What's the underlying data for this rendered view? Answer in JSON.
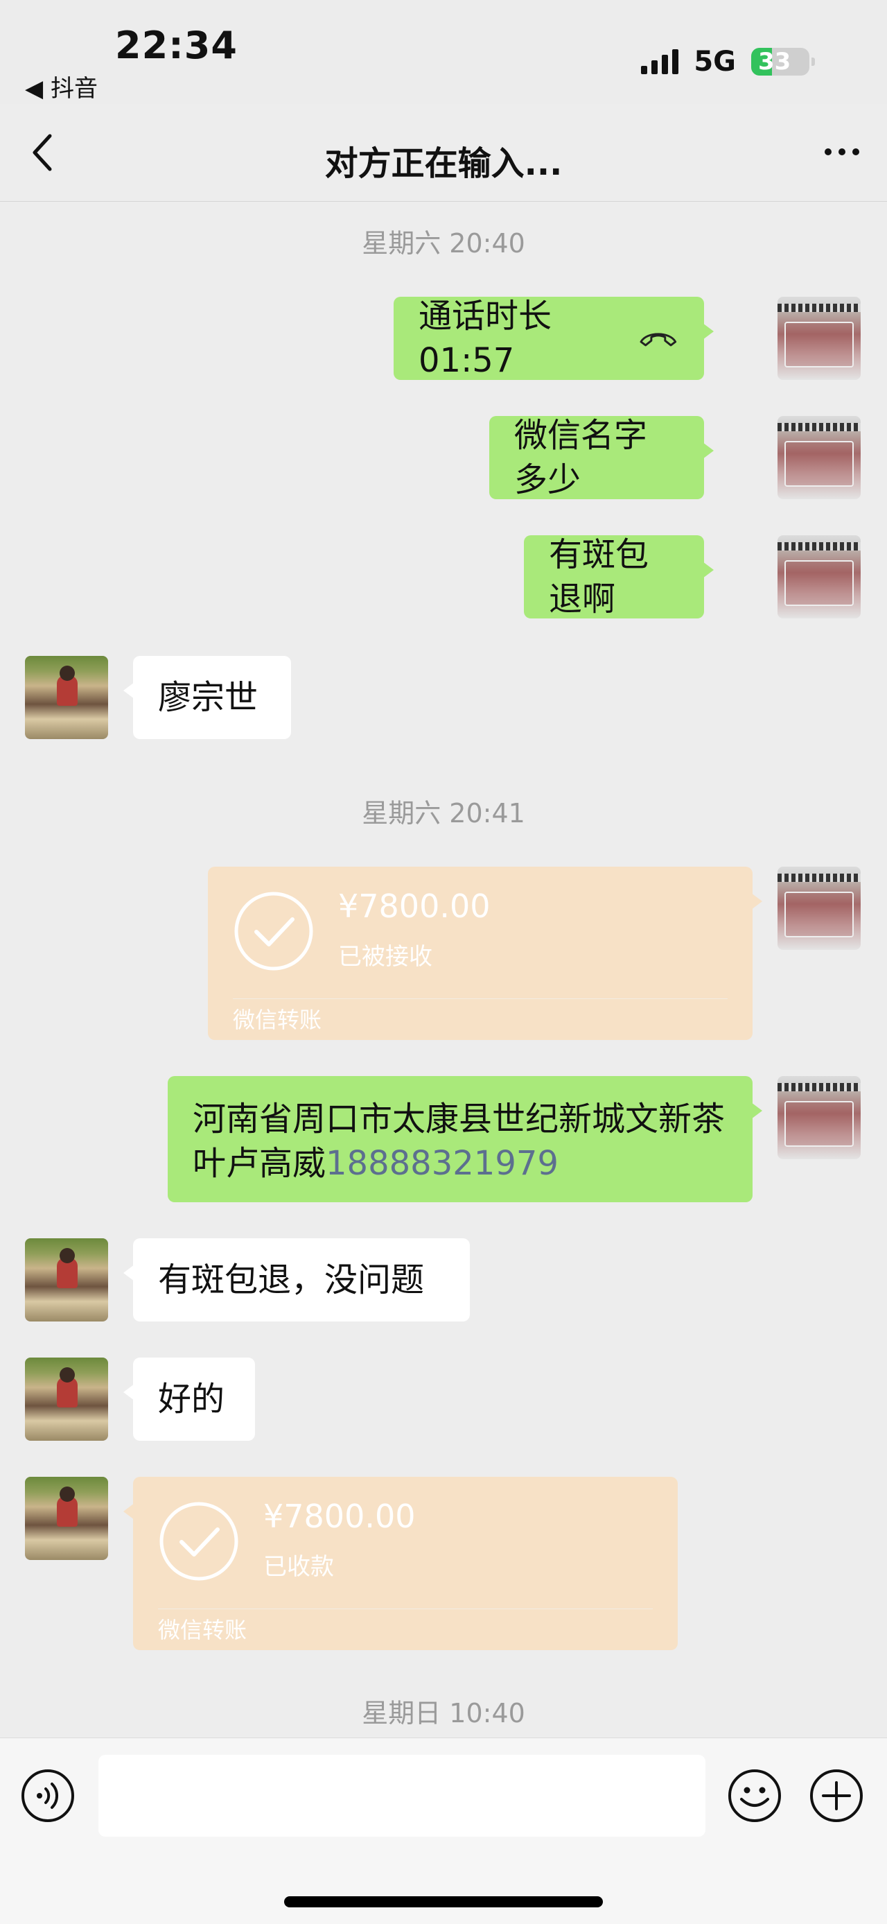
{
  "status_bar": {
    "time": "22:34",
    "back_app": "◀ 抖音",
    "network": "5G",
    "battery": "33"
  },
  "nav": {
    "title": "对方正在输入..."
  },
  "timestamps": {
    "t1": "星期六 20:40",
    "t2": "星期六 20:41",
    "t3": "星期日 10:40"
  },
  "messages": {
    "m1": "通话时长 01:57",
    "m2": "微信名字多少",
    "m3": "有斑包退啊",
    "m4": "廖宗世",
    "m6_address": "河南省周口市太康县世纪新城文新茶叶卢高威",
    "m6_phone": "18888321979",
    "m7": "有斑包退，没问题",
    "m8": "好的"
  },
  "transfers": {
    "sent": {
      "amount": "¥7800.00",
      "status": "已被接收",
      "footer": "微信转账"
    },
    "received": {
      "amount": "¥7800.00",
      "status": "已收款",
      "footer": "微信转账"
    }
  },
  "colors": {
    "bubble_me": "#a9e97a",
    "bubble_other": "#ffffff",
    "transfer": "#f7e1c6",
    "background": "#ededed"
  }
}
